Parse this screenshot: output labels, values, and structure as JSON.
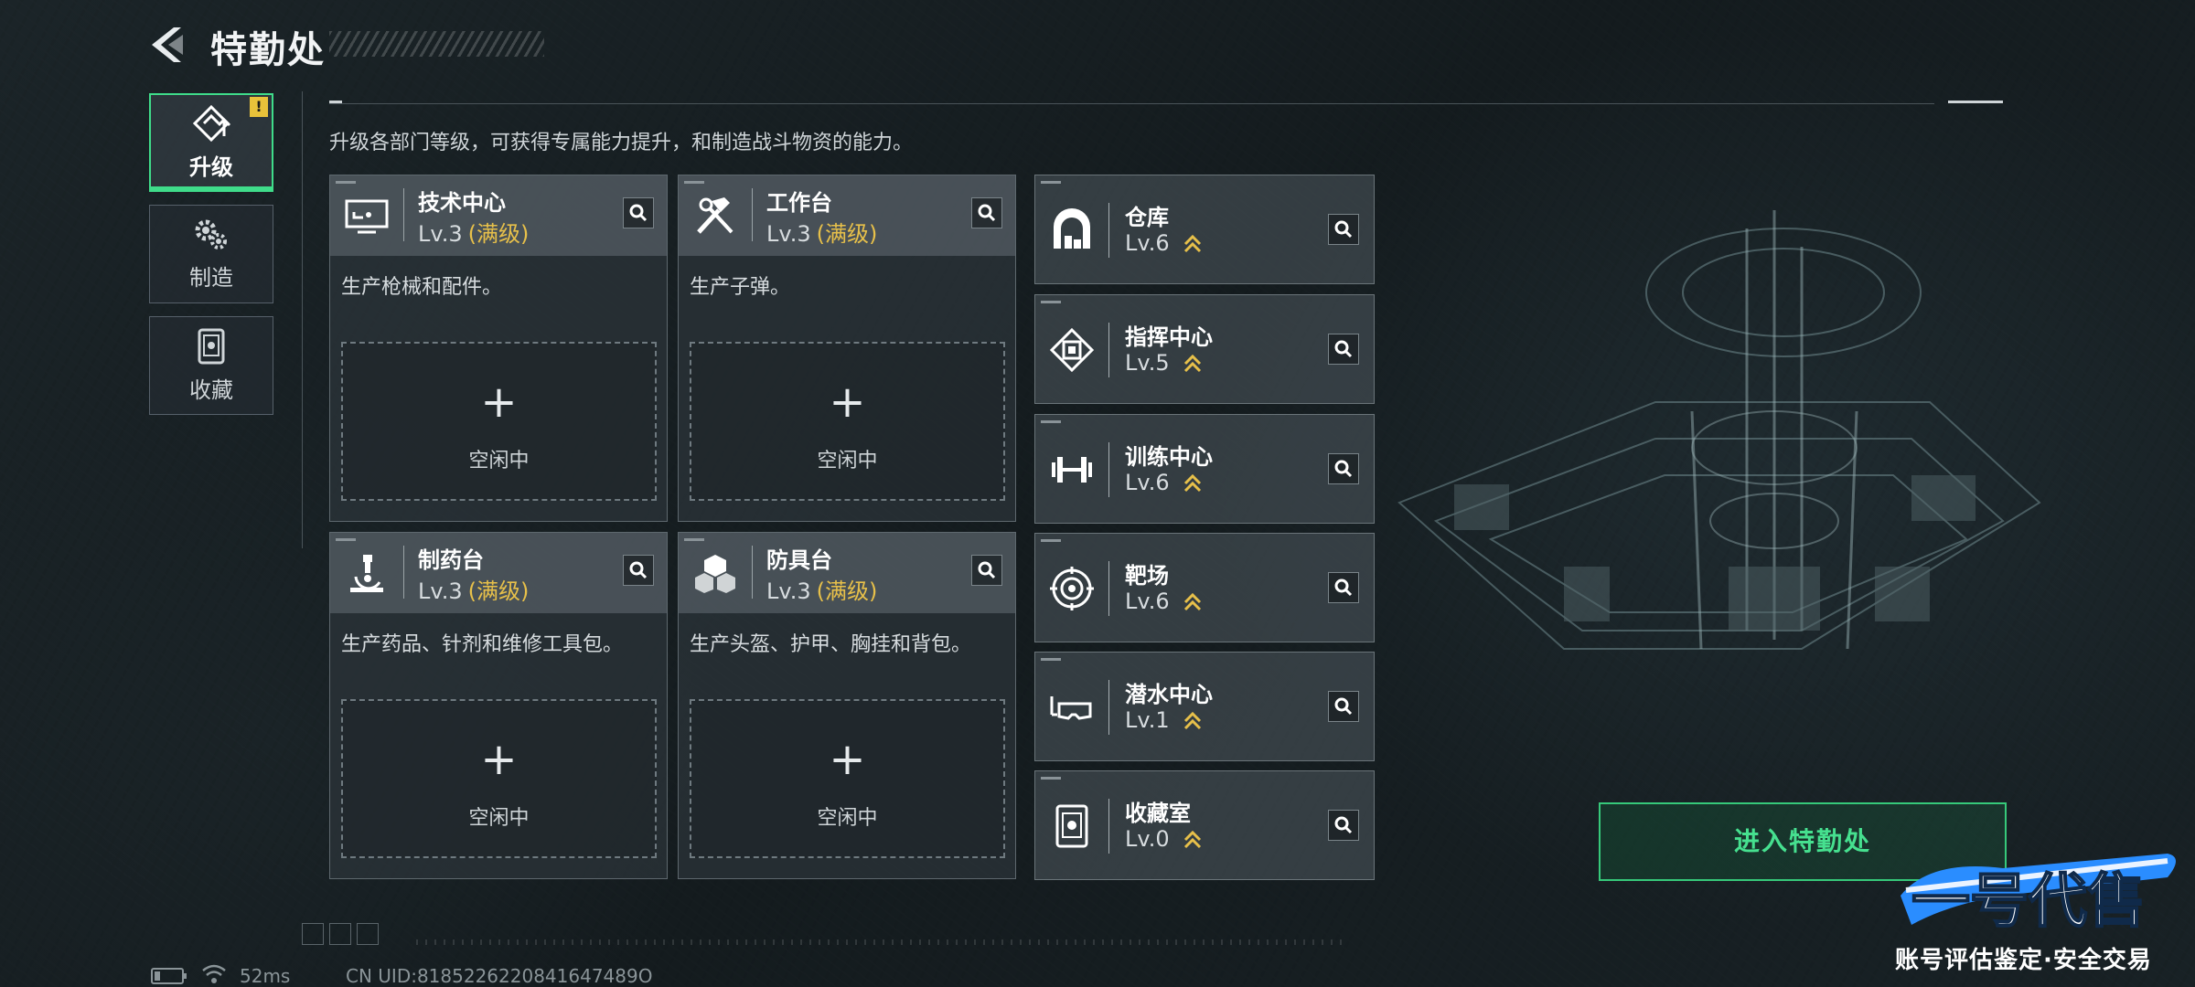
{
  "header": {
    "title": "特勤处"
  },
  "tabs": [
    {
      "label": "升级",
      "icon": "upgrade-icon",
      "active": true,
      "warning": "!"
    },
    {
      "label": "制造",
      "icon": "gear-cluster-icon",
      "active": false
    },
    {
      "label": "收藏",
      "icon": "collection-capsule-icon",
      "active": false
    }
  ],
  "intro": "升级各部门等级，可获得专属能力提升，和制造战斗物资的能力。",
  "stations": [
    {
      "name": "技术中心",
      "level": "Lv.3",
      "status": "(满级)",
      "desc": "生产枪械和配件。",
      "slot_plus": "+",
      "slot_label": "空闲中",
      "icon": "monitor-icon"
    },
    {
      "name": "工作台",
      "level": "Lv.3",
      "status": "(满级)",
      "desc": "生产子弹。",
      "slot_plus": "+",
      "slot_label": "空闲中",
      "icon": "hammer-wrench-icon"
    },
    {
      "name": "制药台",
      "level": "Lv.3",
      "status": "(满级)",
      "desc": "生产药品、针剂和维修工具包。",
      "slot_plus": "+",
      "slot_label": "空闲中",
      "icon": "microscope-icon"
    },
    {
      "name": "防具台",
      "level": "Lv.3",
      "status": "(满级)",
      "desc": "生产头盔、护甲、胸挂和背包。",
      "slot_plus": "+",
      "slot_label": "空闲中",
      "icon": "armor-cubes-icon"
    }
  ],
  "facilities": [
    {
      "name": "仓库",
      "level": "Lv.6",
      "icon": "warehouse-icon"
    },
    {
      "name": "指挥中心",
      "level": "Lv.5",
      "icon": "command-chip-icon"
    },
    {
      "name": "训练中心",
      "level": "Lv.6",
      "icon": "dumbbell-icon"
    },
    {
      "name": "靶场",
      "level": "Lv.6",
      "icon": "target-icon"
    },
    {
      "name": "潜水中心",
      "level": "Lv.1",
      "icon": "diving-mask-icon"
    },
    {
      "name": "收藏室",
      "level": "Lv.0",
      "icon": "collection-capsule-icon"
    }
  ],
  "enter_button": "进入特勤处",
  "watermark": {
    "brand": "一号代售",
    "slogan": "账号评估鉴定·安全交易"
  },
  "status_bar": {
    "ping": "52ms",
    "uid": "CN UID:8185226220841647489O"
  },
  "colors": {
    "accent_green": "#3fdc8a",
    "max_level_gold": "#e7c04a",
    "warning_yellow": "#e9c23a"
  }
}
